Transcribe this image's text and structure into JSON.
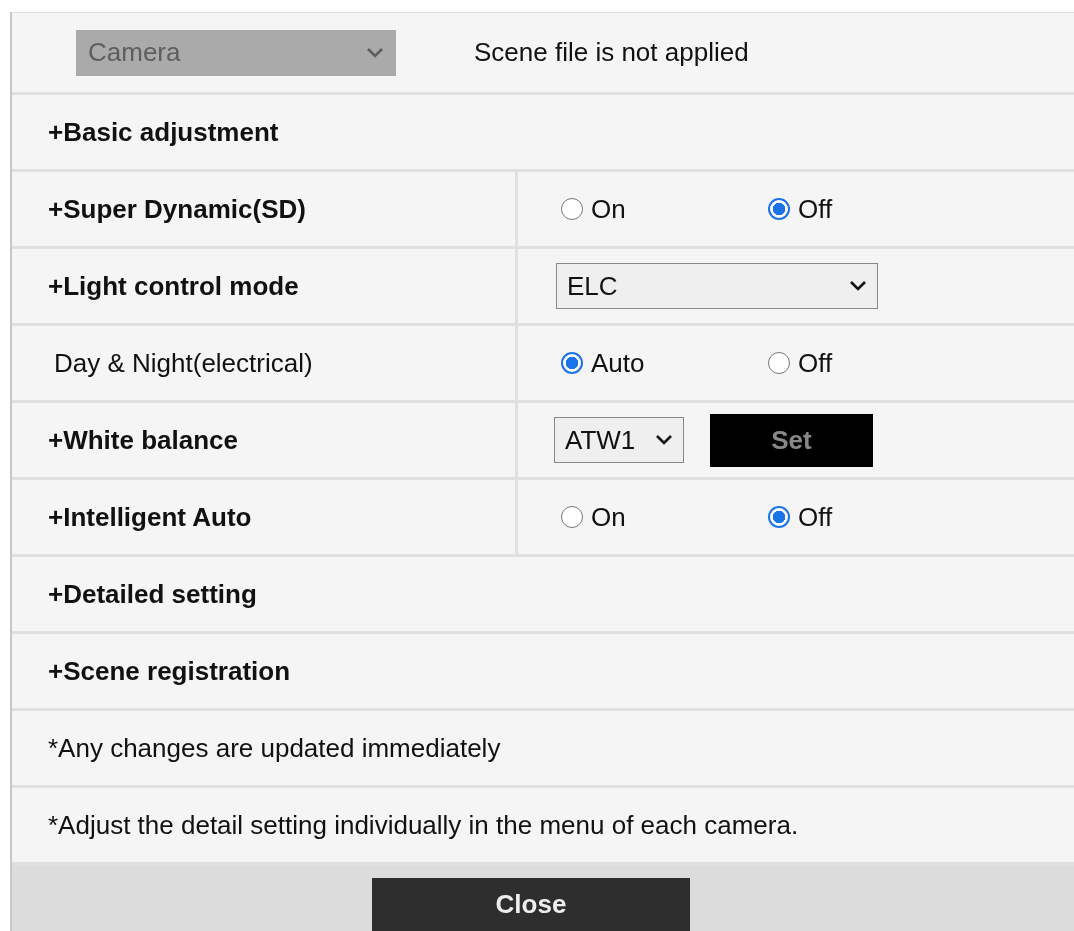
{
  "camera_select": {
    "value": "Camera",
    "disabled": true
  },
  "scene_status": "Scene file is not applied",
  "rows": [
    {
      "kind": "section",
      "label": "+Basic adjustment"
    },
    {
      "kind": "radio",
      "label": "+Super Dynamic(SD)",
      "bold": true,
      "options": [
        {
          "label": "On",
          "selected": false
        },
        {
          "label": "Off",
          "selected": true
        }
      ]
    },
    {
      "kind": "select",
      "label": "+Light control mode",
      "bold": true,
      "value": "ELC"
    },
    {
      "kind": "radio",
      "label": "Day & Night(electrical)",
      "bold": false,
      "options": [
        {
          "label": "Auto",
          "selected": true
        },
        {
          "label": "Off",
          "selected": false
        }
      ]
    },
    {
      "kind": "select_button",
      "label": "+White balance",
      "bold": true,
      "value": "ATW1",
      "button": "Set"
    },
    {
      "kind": "radio",
      "label": "+Intelligent Auto",
      "bold": true,
      "options": [
        {
          "label": "On",
          "selected": false
        },
        {
          "label": "Off",
          "selected": true
        }
      ]
    },
    {
      "kind": "section",
      "label": "+Detailed setting"
    },
    {
      "kind": "section",
      "label": "+Scene registration"
    }
  ],
  "notes": [
    "*Any changes are updated immediately",
    "*Adjust the detail setting individually in the menu of each camera."
  ],
  "close_button": "Close"
}
